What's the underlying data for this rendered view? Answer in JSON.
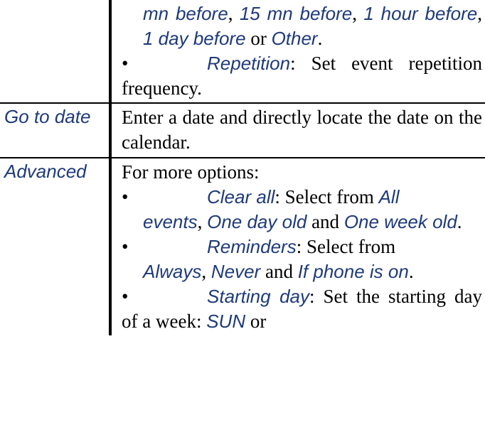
{
  "rows": {
    "r1": {
      "label": "",
      "frag_a": "mn before",
      "sep1": ", ",
      "frag_b": "15 mn before",
      "sep2": ", ",
      "frag_c": "1 hour before",
      "sep3": ", ",
      "frag_d": "1 day before",
      "or": " or ",
      "frag_e": "Other",
      "dot": ".",
      "bul2_em": "Repetition",
      "bul2_rest": ": Set event repetition frequency."
    },
    "r2": {
      "label": "Go to date",
      "text": "Enter a date and directly locate the date on the calendar."
    },
    "r3": {
      "label": "Advanced",
      "intro": "For more options:",
      "b1_em": "Clear all",
      "b1_a": ": Select from ",
      "b1_opt1": "All events",
      "b1_s1": ", ",
      "b1_opt2": "One day old",
      "b1_and": " and ",
      "b1_opt3": "One week old",
      "b1_dot": ".",
      "b2_em": "Reminders",
      "b2_a": ": Select from ",
      "b2_opt1": "Always",
      "b2_s1": ", ",
      "b2_opt2": "Never",
      "b2_and": " and ",
      "b2_opt3": "If phone is on",
      "b2_dot": ".",
      "b3_em": "Starting day",
      "b3_a": ": Set the starting day of a week: ",
      "b3_opt1": "SUN",
      "b3_or": " or"
    }
  }
}
